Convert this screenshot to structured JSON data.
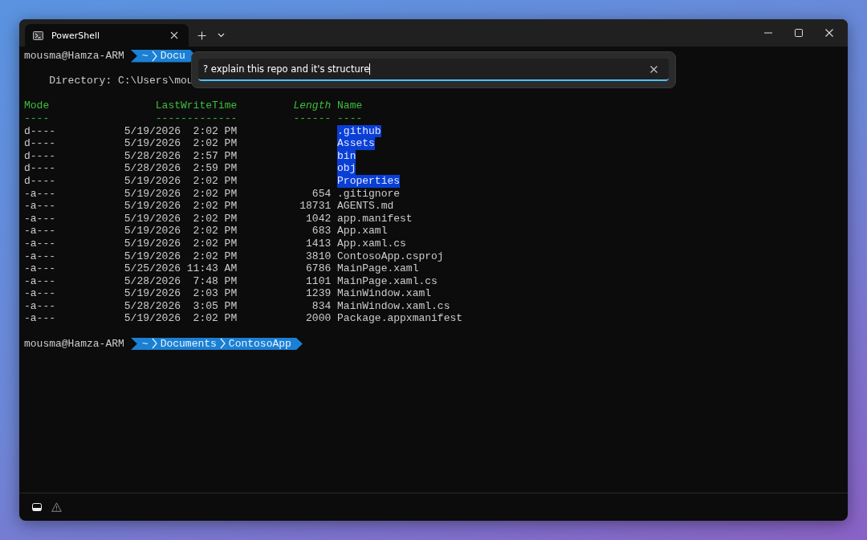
{
  "tabs": [
    {
      "title": "PowerShell",
      "selected": true
    }
  ],
  "terminal": {
    "prompt_top": {
      "user": "mousma@Hamza-ARM",
      "path": [
        "~",
        "Docu"
      ]
    },
    "directory_line": "Directory: C:\\Users\\mou",
    "table": {
      "columns": [
        {
          "label": "Mode",
          "underline": "----",
          "italic": false
        },
        {
          "label": "LastWriteTime",
          "underline": "-------------",
          "italic": false
        },
        {
          "label": "Length",
          "underline": "------",
          "italic": true
        },
        {
          "label": "Name",
          "underline": "----",
          "italic": false
        }
      ],
      "rows": [
        {
          "kind": "directory",
          "mode": "d----",
          "time": "5/19/2026  2:02 PM",
          "name": ".github"
        },
        {
          "kind": "directory",
          "mode": "d----",
          "time": "5/19/2026  2:02 PM",
          "name": "Assets"
        },
        {
          "kind": "directory",
          "mode": "d----",
          "time": "5/28/2026  2:57 PM",
          "name": "bin"
        },
        {
          "kind": "directory",
          "mode": "d----",
          "time": "5/28/2026  2:59 PM",
          "name": "obj"
        },
        {
          "kind": "directory",
          "mode": "d----",
          "time": "5/19/2026  2:02 PM",
          "name": "Properties"
        },
        {
          "kind": "file",
          "mode": "-a---",
          "time": "5/19/2026  2:02 PM",
          "length": "654",
          "name": ".gitignore"
        },
        {
          "kind": "file",
          "mode": "-a---",
          "time": "5/19/2026  2:02 PM",
          "length": "18731",
          "name": "AGENTS.md"
        },
        {
          "kind": "file",
          "mode": "-a---",
          "time": "5/19/2026  2:02 PM",
          "length": "1042",
          "name": "app.manifest"
        },
        {
          "kind": "file",
          "mode": "-a---",
          "time": "5/19/2026  2:02 PM",
          "length": "683",
          "name": "App.xaml"
        },
        {
          "kind": "file",
          "mode": "-a---",
          "time": "5/19/2026  2:02 PM",
          "length": "1413",
          "name": "App.xaml.cs"
        },
        {
          "kind": "file",
          "mode": "-a---",
          "time": "5/19/2026  2:02 PM",
          "length": "3810",
          "name": "ContosoApp.csproj"
        },
        {
          "kind": "file",
          "mode": "-a---",
          "time": "5/25/2026 11:43 AM",
          "length": "6786",
          "name": "MainPage.xaml"
        },
        {
          "kind": "file",
          "mode": "-a---",
          "time": "5/28/2026  7:48 PM",
          "length": "1101",
          "name": "MainPage.xaml.cs"
        },
        {
          "kind": "file",
          "mode": "-a---",
          "time": "5/19/2026  2:03 PM",
          "length": "1239",
          "name": "MainWindow.xaml"
        },
        {
          "kind": "file",
          "mode": "-a---",
          "time": "5/28/2026  3:05 PM",
          "length": "834",
          "name": "MainWindow.xaml.cs"
        },
        {
          "kind": "file",
          "mode": "-a---",
          "time": "5/19/2026  2:02 PM",
          "length": "2000",
          "name": "Package.appxmanifest"
        }
      ]
    },
    "prompt_bottom": {
      "user": "mousma@Hamza-ARM",
      "path": [
        "~",
        "Documents",
        "ContosoApp"
      ]
    }
  },
  "command_palette": {
    "value": "? explain this repo and it's structure"
  }
}
